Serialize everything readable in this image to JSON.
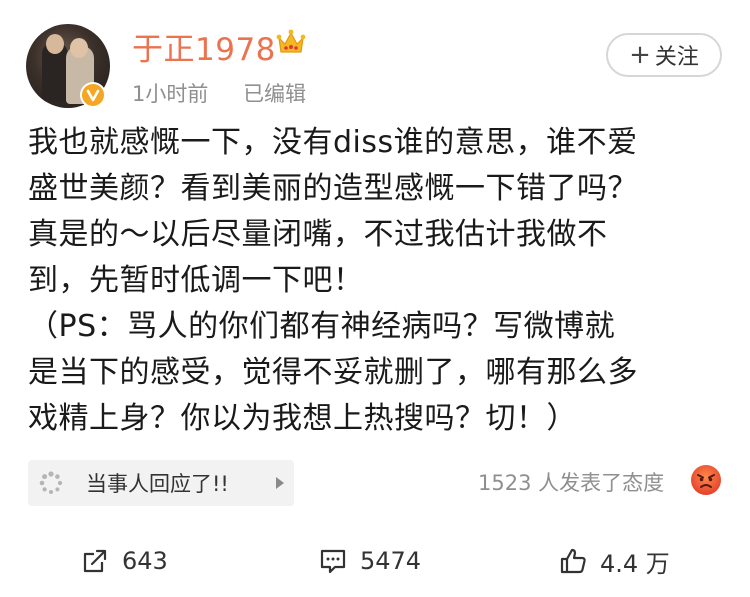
{
  "user": {
    "name": "于正1978",
    "time": "1小时前",
    "edited": "已编辑",
    "follow_label": "关注"
  },
  "post": {
    "lines": [
      "我也就感慨一下，没有diss谁的意思，谁不爱",
      "盛世美颜？看到美丽的造型感慨一下错了吗？",
      "真是的～以后尽量闭嘴，不过我估计我做不",
      "到，先暂时低调一下吧！",
      "（PS：骂人的你们都有神经病吗？写微博就",
      "是当下的感受，觉得不妥就删了，哪有那么多",
      "戏精上身？你以为我想上热搜吗？切！）"
    ]
  },
  "topic": {
    "label": "当事人回应了!!"
  },
  "attitude": {
    "text": "1523 人发表了态度",
    "icon": "angry-emoji-icon"
  },
  "footer": {
    "repost_count": "643",
    "comment_count": "5474",
    "like_count": "4.4 万"
  },
  "colors": {
    "username": "#eb7350",
    "meta_gray": "#8f8f8f",
    "badge": "#f5a623"
  }
}
